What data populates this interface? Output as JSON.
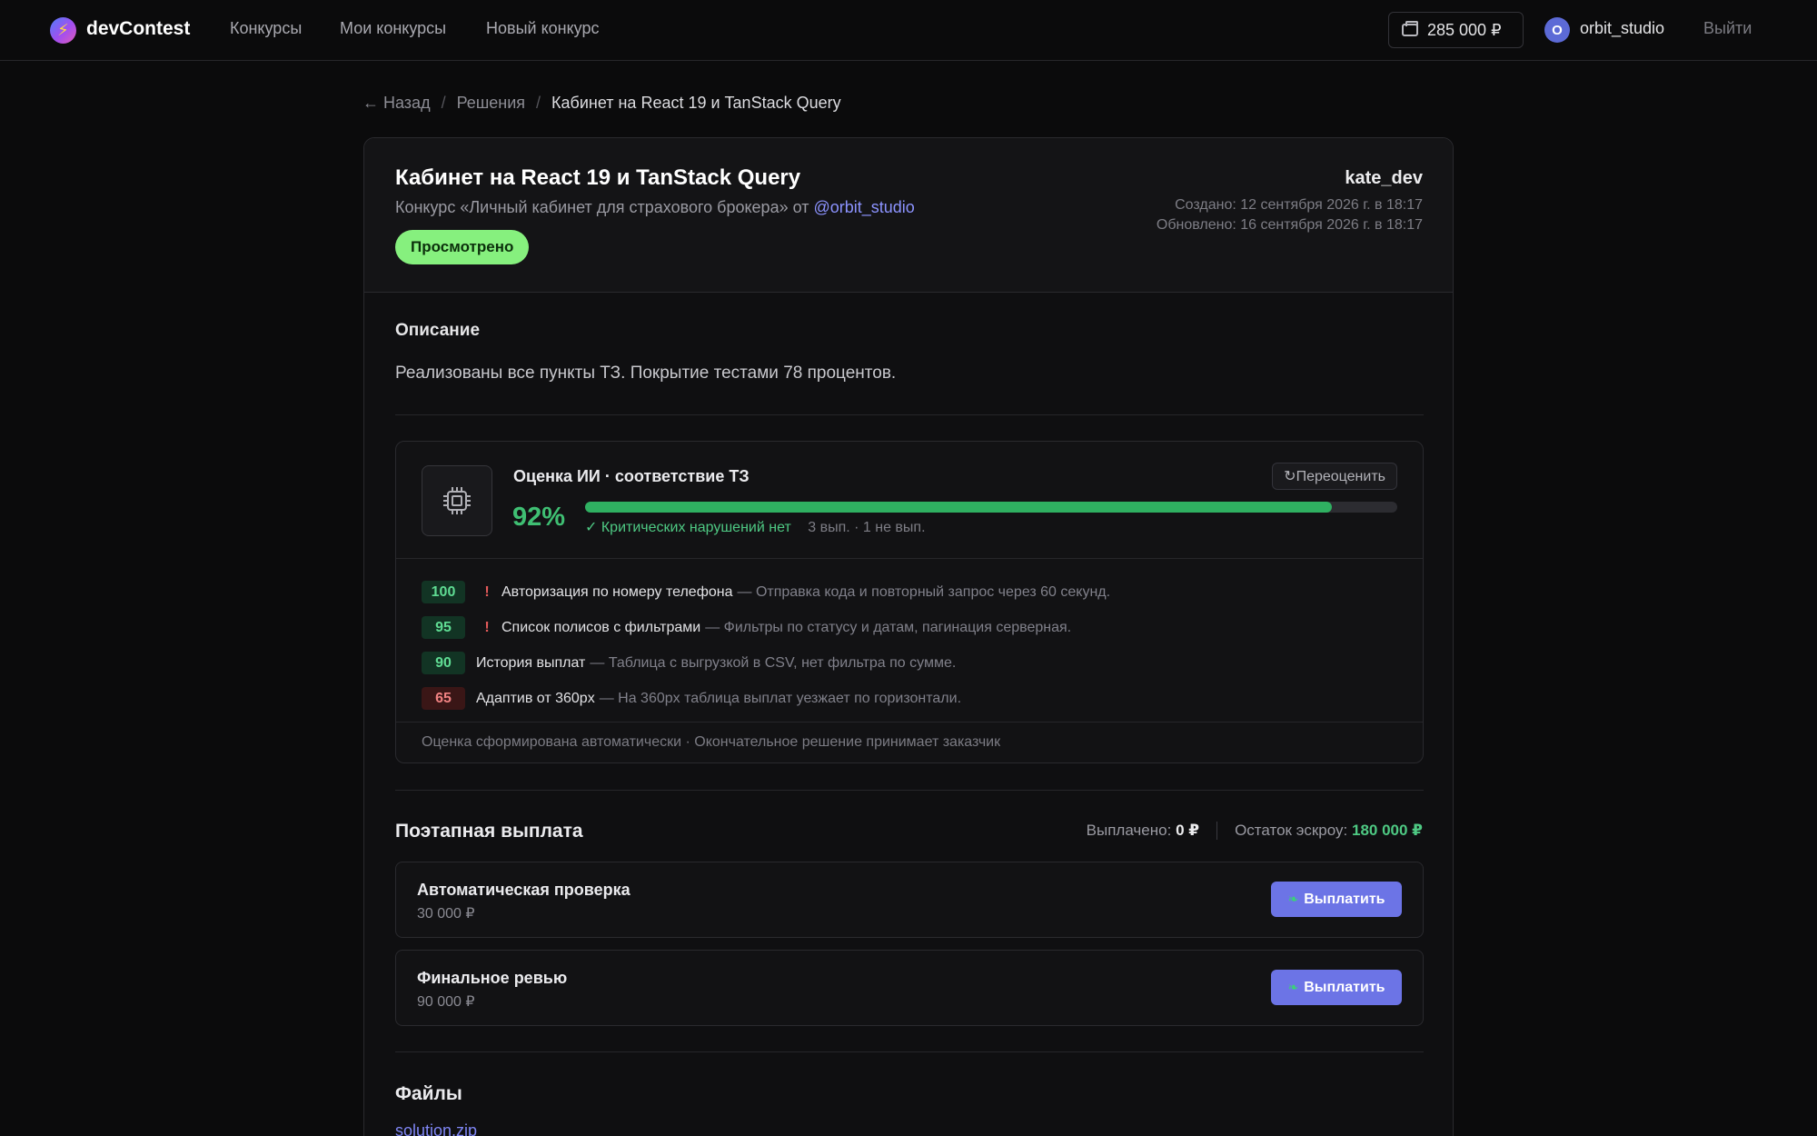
{
  "header": {
    "brand": "devContest",
    "logo_icon": "lightning-bolt-icon",
    "nav": [
      "Конкурсы",
      "Мои конкурсы",
      "Новый конкурс"
    ],
    "balance": "285 000 ₽",
    "balance_icon": "wallet-icon",
    "avatar_letter": "O",
    "username": "orbit_studio",
    "logout": "Выйти"
  },
  "breadcrumbs": {
    "back": "← Назад",
    "parent": "Решения",
    "current": "Кабинет на React 19 и TanStack Query"
  },
  "solution": {
    "title": "Кабинет на React 19 и TanStack Query",
    "contest_prefix": "Конкурс «Личный кабинет для страхового брокера» от",
    "contest_owner": "@orbit_studio",
    "status": "Просмотрено",
    "author": "kate_dev",
    "created": "Создано: 12 сентября 2026 г. в 18:17",
    "updated": "Обновлено: 16 сентября 2026 г. в 18:17"
  },
  "description": {
    "heading": "Описание",
    "text": "Реализованы все пункты ТЗ. Покрытие тестами 78 процентов."
  },
  "ai_review": {
    "icon": "cpu-chip-icon",
    "title": "Оценка ИИ · соответствие ТЗ",
    "reassess_label": "↻Переоценить",
    "score_label": "92%",
    "score": 0.92,
    "ok_text": "✓ Критических нарушений нет",
    "counts": "3 вып. · 1 не вып.",
    "items": [
      {
        "score": "100",
        "level": "good",
        "critical": "!",
        "name": "Авторизация по номеру телефона",
        "note": "— Отправка кода и повторный запрос через 60 секунд."
      },
      {
        "score": "95",
        "level": "good",
        "critical": "!",
        "name": "Список полисов с фильтрами",
        "note": "— Фильтры по статусу и датам, пагинация серверная."
      },
      {
        "score": "90",
        "level": "good",
        "critical": "",
        "name": "История выплат",
        "note": "— Таблица с выгрузкой в CSV, нет фильтра по сумме."
      },
      {
        "score": "65",
        "level": "bad",
        "critical": "",
        "name": "Адаптив от 360px",
        "note": "— На 360px таблица выплат уезжает по горизонтали."
      }
    ],
    "footer": "Оценка сформирована автоматически · Окончательное решение принимает заказчик"
  },
  "payout": {
    "heading": "Поэтапная выплата",
    "paid_label": "Выплачено:",
    "paid_value": "0 ₽",
    "escrow_label": "Остаток эскроу:",
    "escrow_value": "180 000 ₽",
    "stages": [
      {
        "name": "Автоматическая проверка",
        "amount": "30 000 ₽",
        "button": "Выплатить"
      },
      {
        "name": "Финальное ревью",
        "amount": "90 000 ₽",
        "button": "Выплатить"
      }
    ],
    "button_icon": "money-wings-icon"
  },
  "files": {
    "heading": "Файлы",
    "items": [
      "solution.zip"
    ]
  },
  "colors": {
    "accent": "#6c74e6",
    "success": "#3fbf73",
    "status_bg": "#86f07e",
    "danger": "#e35a5a"
  }
}
